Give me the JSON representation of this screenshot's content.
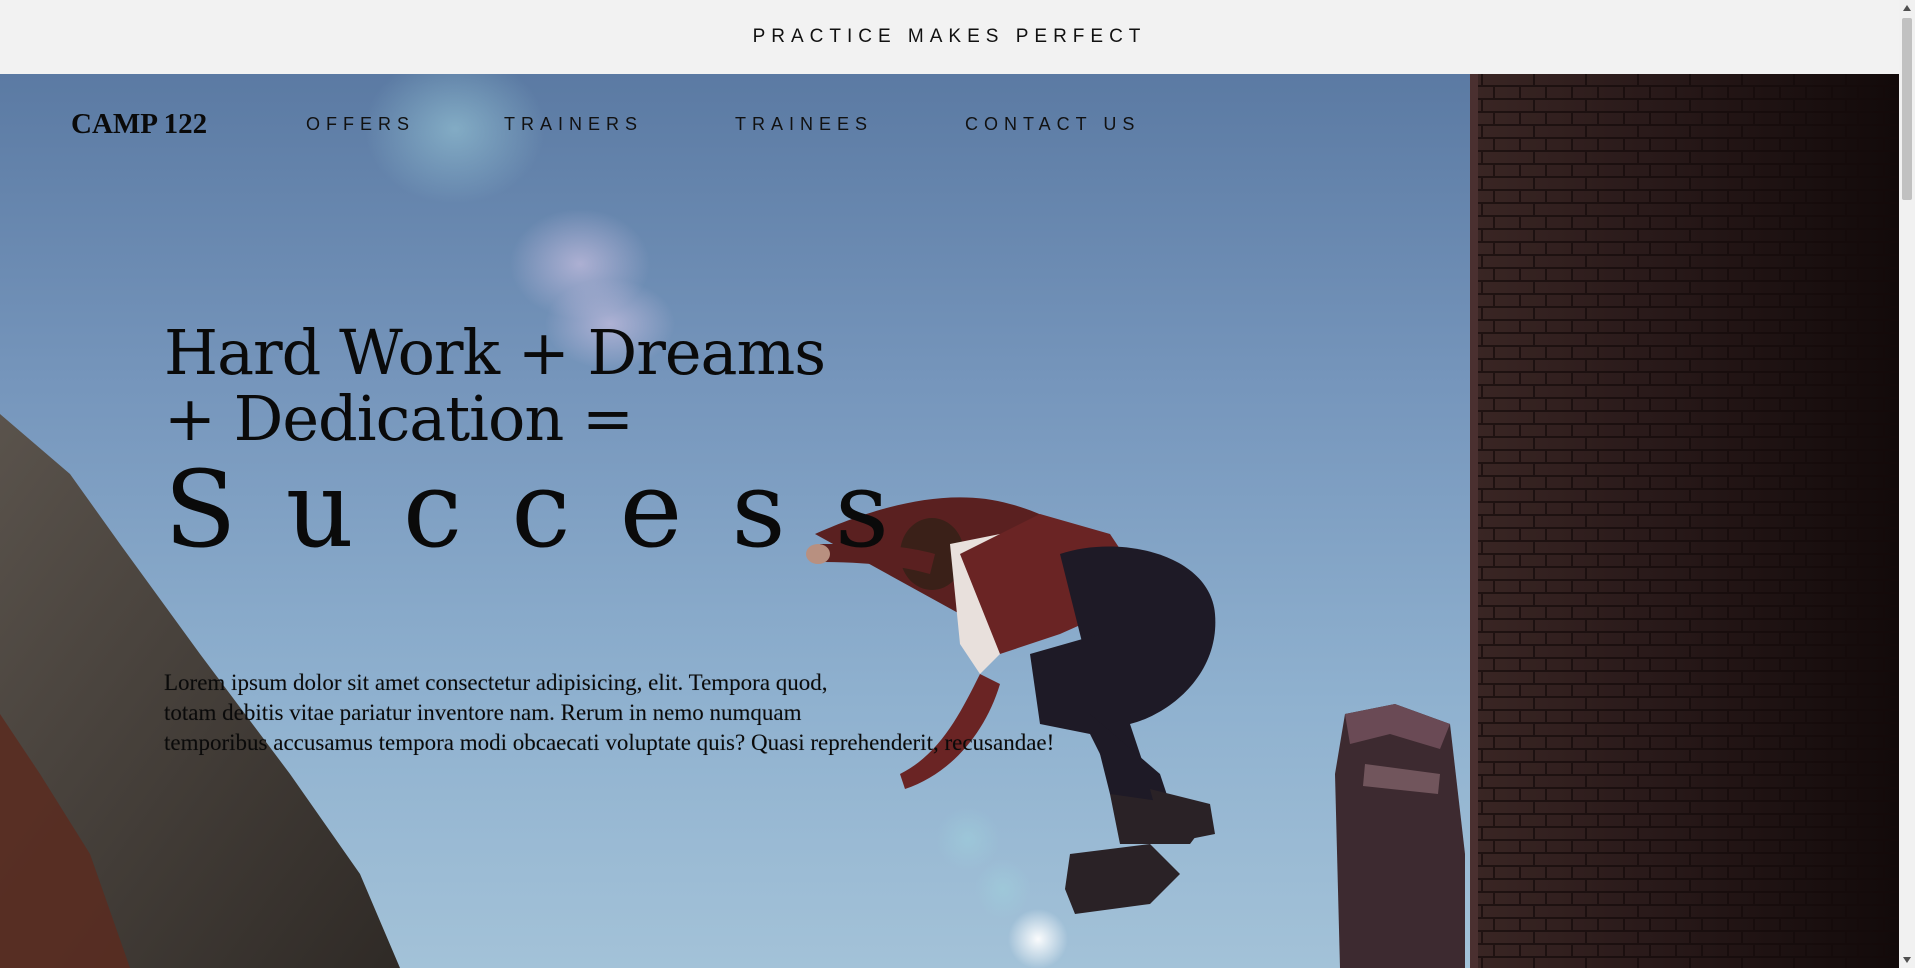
{
  "banner": {
    "text": "PRACTICE MAKES PERFECT"
  },
  "nav": {
    "brand": "CAMP 122",
    "links": [
      "OFFERS",
      "TRAINERS",
      "TRAINEES",
      "CONTACT US"
    ]
  },
  "hero": {
    "title_line1": "Hard Work + Dreams",
    "title_line2": "+ Dedication =",
    "title_big": "Success",
    "paragraph_line1": "Lorem ipsum dolor sit amet consectetur adipisicing, elit. Tempora quod,",
    "paragraph_line2": "totam debitis vitae pariatur inventore nam. Rerum in nemo numquam",
    "paragraph_line3": "temporibus accusamus tempora modi obcaecati voluptate quis? Quasi reprehenderit, recusandae!",
    "background_image": "parkour-jumper-photo"
  },
  "colors": {
    "banner_bg": "#f2f2f2",
    "sky_top": "#5b7aa3",
    "sky_bottom": "#a3c2d8",
    "text": "#0a0a0a"
  }
}
